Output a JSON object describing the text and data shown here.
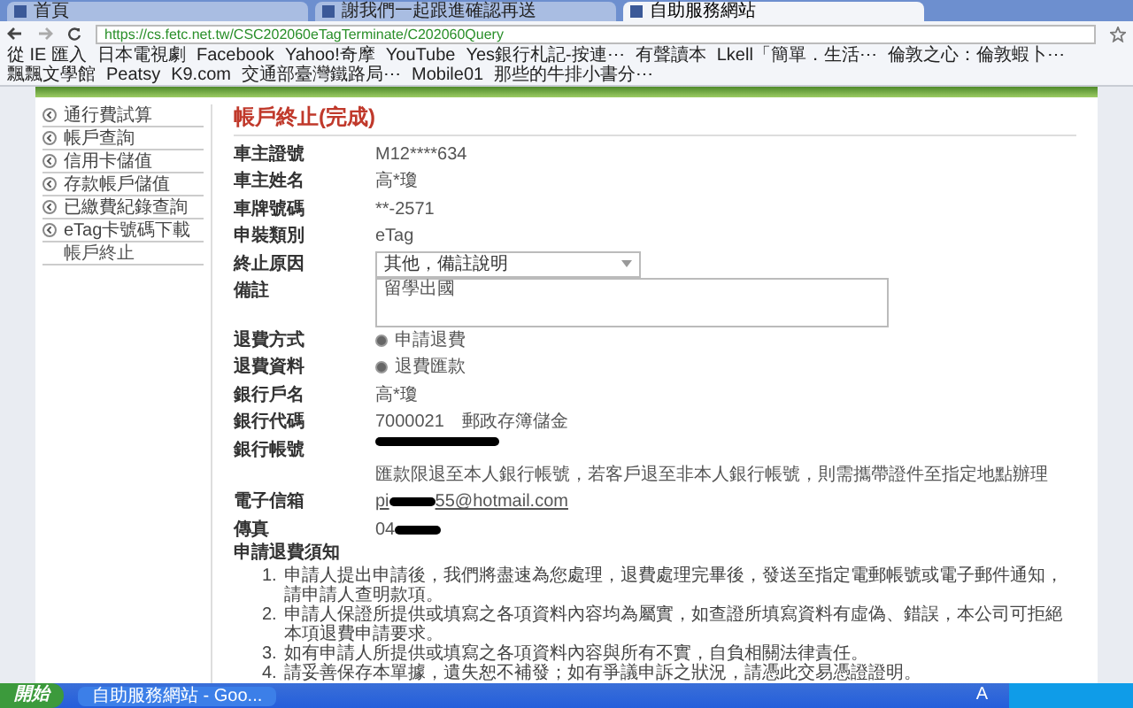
{
  "browser": {
    "tabs": [
      {
        "label": "首頁",
        "selected": false
      },
      {
        "label": "謝我們一起跟進確認再送",
        "selected": false
      },
      {
        "label": "自助服務網站",
        "selected": true
      }
    ],
    "address": "https://cs.fetc.net.tw/CSC202060eTagTerminate/C202060Query",
    "bookmarks": [
      {
        "label": "從 IE 匯入"
      },
      {
        "label": "日本電視劇"
      },
      {
        "label": "Facebook"
      },
      {
        "label": "Yahoo!奇摩"
      },
      {
        "label": "YouTube"
      },
      {
        "label": "Yes銀行札記-按連⋯"
      },
      {
        "label": "有聲讀本"
      },
      {
        "label": "Lkell「簡單．生活⋯"
      },
      {
        "label": "倫敦之心：倫敦蝦卜⋯"
      },
      {
        "label": "飄飄文學館"
      },
      {
        "label": "Peatsy"
      },
      {
        "label": "K9.com"
      },
      {
        "label": "交通部臺灣鐵路局⋯"
      },
      {
        "label": "Mobile01"
      },
      {
        "label": "那些的牛排小書分⋯"
      }
    ]
  },
  "sidebar": {
    "items": [
      {
        "label": "通行費試算",
        "selected": false
      },
      {
        "label": "帳戶查詢",
        "selected": false
      },
      {
        "label": "信用卡儲值",
        "selected": false
      },
      {
        "label": "存款帳戶儲值",
        "selected": false
      },
      {
        "label": "已繳費紀錄查詢",
        "selected": false
      },
      {
        "label": "eTag卡號碼下載",
        "selected": false
      },
      {
        "label": "帳戶終止",
        "selected": true
      }
    ]
  },
  "title": "帳戶終止(完成)",
  "fields": [
    {
      "kind": "text",
      "label": "車主證號",
      "value": "M12****634"
    },
    {
      "kind": "text",
      "label": "車主姓名",
      "value": "高*瓊"
    },
    {
      "kind": "text",
      "label": "車牌號碼",
      "value": "**-2571"
    },
    {
      "kind": "text",
      "label": "申裝類別",
      "value": "eTag"
    },
    {
      "kind": "select",
      "label": "終止原因",
      "value": "其他，備註說明"
    },
    {
      "kind": "textarea",
      "label": "備註",
      "value": "留學出國"
    },
    {
      "kind": "radio",
      "label": "退費方式",
      "value": "申請退費",
      "checked": true
    },
    {
      "kind": "radio",
      "label": "退費資料",
      "value": "退費匯款",
      "checked": true
    },
    {
      "kind": "text",
      "label": "銀行戶名",
      "value": "高*瓊"
    },
    {
      "kind": "text",
      "label": "銀行代碼",
      "value": "7000021　郵政存簿儲金"
    },
    {
      "kind": "redacted",
      "label": "銀行帳號"
    },
    {
      "kind": "note",
      "value": "匯款限退至本人銀行帳號，若客戶退至非本人銀行帳號，則需攜帶證件至指定地點辦理"
    },
    {
      "kind": "partial",
      "label": "電子信箱",
      "prefix": "pi",
      "suffix": "55@hotmail.com"
    },
    {
      "kind": "partial",
      "label": "傳真",
      "prefix": "04"
    }
  ],
  "notice": {
    "title": "申請退費須知",
    "items": [
      {
        "number": "1.",
        "text": "申請人提出申請後，我們將盡速為您處理，退費處理完畢後，發送至指定電郵帳號或電子郵件通知，請申請人查明款項。"
      },
      {
        "number": "2.",
        "text": "申請人保證所提供或填寫之各項資料內容均為屬實，如查證所填寫資料有虛偽、錯誤，本公司可拒絕本項退費申請要求。"
      },
      {
        "number": "3.",
        "text": "如有申請人所提供或填寫之各項資料內容與所有不實，自負相關法律責任。"
      },
      {
        "number": "4.",
        "text": "請妥善保存本單據，遺失恕不補發；如有爭議申訴之狀況，請憑此交易憑證證明。"
      }
    ]
  },
  "taskbar": {
    "start": "開始",
    "task": "自助服務網站 - Goo...",
    "ime": "A"
  }
}
